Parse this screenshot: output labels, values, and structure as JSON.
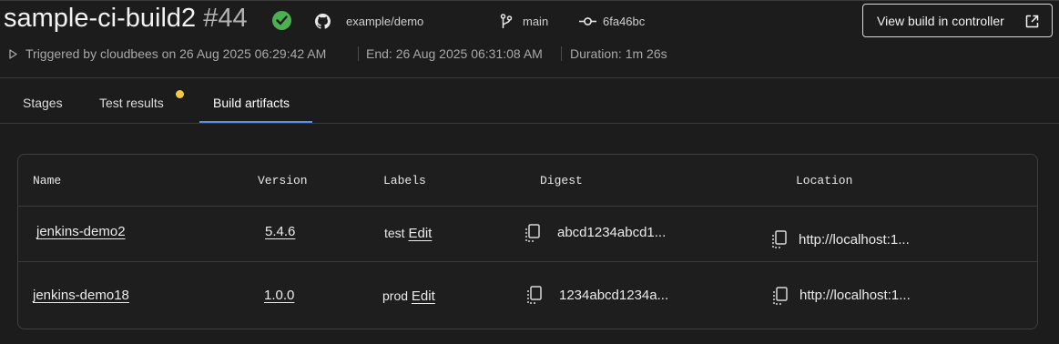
{
  "header": {
    "build_name": "sample-ci-build2",
    "build_number": "#44",
    "status_color": "#4caf50",
    "repo": "example/demo",
    "branch": "main",
    "commit": "6fa46bc",
    "view_button_label": "View build in controller",
    "triggered": "Triggered by cloudbees on 26 Aug 2025 06:29:42 AM",
    "end": "End: 26 Aug 2025 06:31:08 AM",
    "duration": "Duration: 1m 26s"
  },
  "tabs": [
    {
      "label": "Stages"
    },
    {
      "label": "Test results",
      "has_notification": true
    },
    {
      "label": "Build artifacts",
      "active": true
    }
  ],
  "accent_color": "#5b8def",
  "table": {
    "columns": [
      "Name",
      "Version",
      "Labels",
      "Digest",
      "Location"
    ],
    "rows": [
      {
        "name": "jenkins-demo2",
        "version": "5.4.6",
        "label": "test",
        "edit": "Edit",
        "digest": "abcd1234abcd1...",
        "location": "http://localhost:1..."
      },
      {
        "name": "jenkins-demo18",
        "version": "1.0.0",
        "label": "prod",
        "edit": "Edit",
        "digest": "1234abcd1234a...",
        "location": "http://localhost:1..."
      }
    ]
  }
}
